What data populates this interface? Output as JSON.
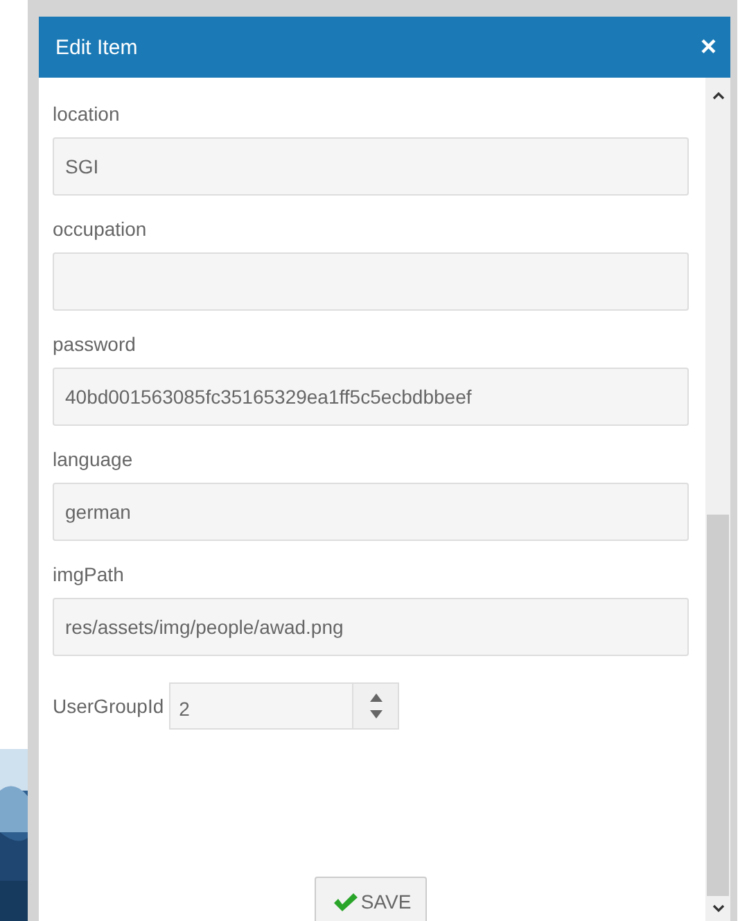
{
  "dialog": {
    "title": "Edit Item",
    "close": "×"
  },
  "fields": [
    {
      "kind": "text",
      "label": "location",
      "value": "SGI"
    },
    {
      "kind": "text",
      "label": "occupation"
    },
    {
      "kind": "text",
      "label": "password",
      "value": "40bd001563085fc35165329ea1ff5c5ecbdbbeef"
    },
    {
      "kind": "text",
      "label": "language",
      "value": "german"
    },
    {
      "kind": "text",
      "label": "imgPath",
      "value": "res/assets/img/people/awad.png"
    },
    {
      "kind": "number",
      "label": "UserGroupId",
      "value": "2"
    }
  ],
  "save_button": "SAVE"
}
